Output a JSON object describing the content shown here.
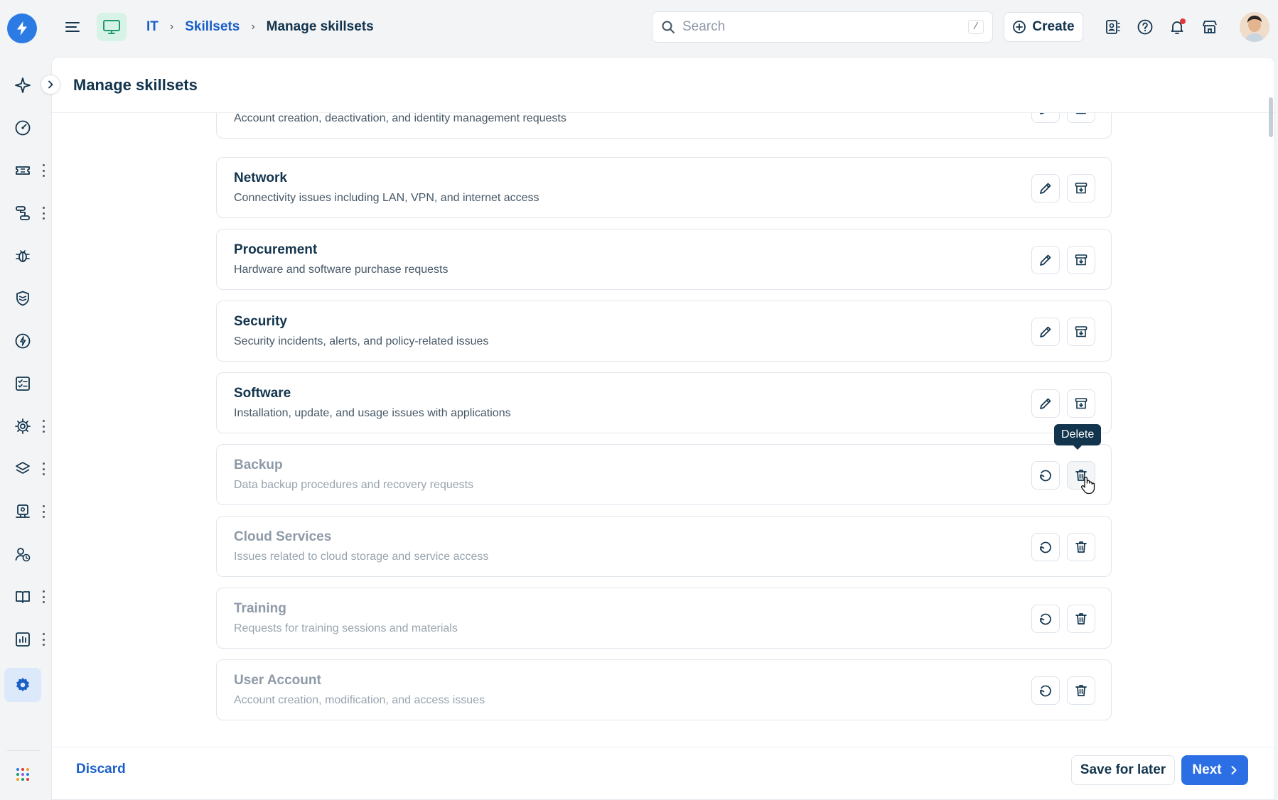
{
  "breadcrumb": {
    "workspace": "IT",
    "section": "Skillsets",
    "current": "Manage skillsets"
  },
  "search": {
    "placeholder": "Search",
    "shortcut": "/"
  },
  "header": {
    "create_label": "Create"
  },
  "panel": {
    "title": "Manage skillsets"
  },
  "skillsets_active": [
    {
      "name": "",
      "description": "Account creation, deactivation, and identity management requests"
    },
    {
      "name": "Network",
      "description": "Connectivity issues including LAN, VPN, and internet access"
    },
    {
      "name": "Procurement",
      "description": "Hardware and software purchase requests"
    },
    {
      "name": "Security",
      "description": "Security incidents, alerts, and policy-related issues"
    },
    {
      "name": "Software",
      "description": "Installation, update, and usage issues with applications"
    }
  ],
  "skillsets_archived": [
    {
      "name": "Backup",
      "description": "Data backup procedures and recovery requests"
    },
    {
      "name": "Cloud Services",
      "description": "Issues related to cloud storage and service access"
    },
    {
      "name": "Training",
      "description": "Requests for training sessions and materials"
    },
    {
      "name": "User Account",
      "description": "Account creation, modification, and access issues"
    }
  ],
  "tooltip": {
    "label": "Delete"
  },
  "footer": {
    "discard_label": "Discard",
    "save_label": "Save for later",
    "next_label": "Next"
  },
  "colors": {
    "primary": "#2c6fe5",
    "link": "#1a5ec7",
    "text": "#12344d",
    "muted": "#8e9aa7",
    "tooltip_bg": "#12344d",
    "notification": "#e43538"
  },
  "icons": {
    "active_actions": [
      "pencil-icon",
      "archive-icon"
    ],
    "archived_actions": [
      "restore-icon",
      "trash-icon"
    ],
    "nav": [
      "sparkle-icon",
      "dashboard-icon",
      "ticket-icon",
      "workflow-icon",
      "bug-icon",
      "shield-icon",
      "bolt-icon",
      "checklist-icon",
      "gears-icon",
      "layers-icon",
      "device-icon",
      "user-clock-icon",
      "book-icon",
      "chart-icon",
      "settings-icon",
      "apps-grid-icon"
    ]
  }
}
